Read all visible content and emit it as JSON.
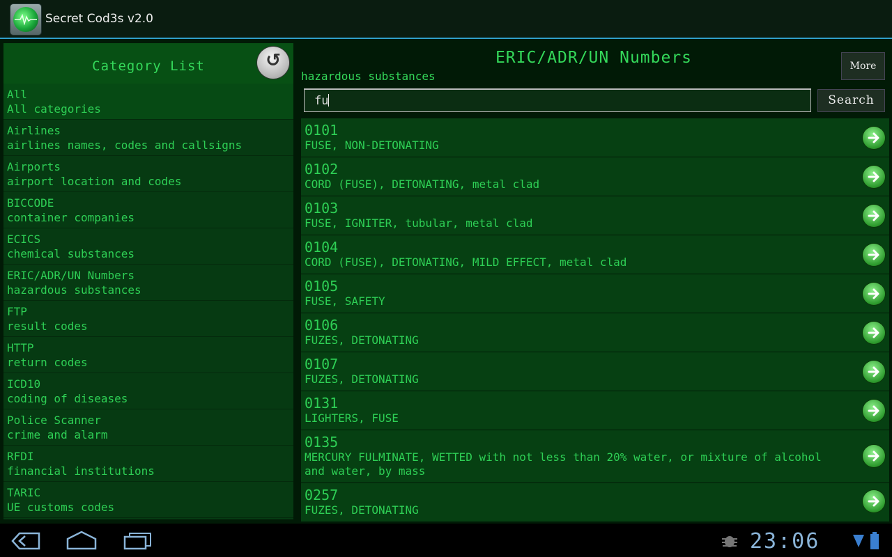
{
  "app": {
    "title": "Secret Cod3s v2.0"
  },
  "sidebar": {
    "title": "Category List",
    "refresh_icon": "↺",
    "items": [
      {
        "name": "All",
        "desc": "All categories"
      },
      {
        "name": "Airlines",
        "desc": "airlines names, codes and callsigns"
      },
      {
        "name": "Airports",
        "desc": "airport location and codes"
      },
      {
        "name": "BICCODE",
        "desc": "container companies"
      },
      {
        "name": "ECICS",
        "desc": "chemical substances"
      },
      {
        "name": "ERIC/ADR/UN Numbers",
        "desc": "hazardous substances"
      },
      {
        "name": "FTP",
        "desc": "result codes"
      },
      {
        "name": "HTTP",
        "desc": "return codes"
      },
      {
        "name": "ICD10",
        "desc": "coding of diseases"
      },
      {
        "name": "Police Scanner",
        "desc": "crime and alarm"
      },
      {
        "name": "RFDI",
        "desc": "financial institutions"
      },
      {
        "name": "TARIC",
        "desc": "UE customs codes"
      }
    ]
  },
  "main": {
    "title": "ERIC/ADR/UN Numbers",
    "subtitle": "hazardous substances",
    "more_label": "More",
    "search_value": "fu",
    "search_label": "Search",
    "results": [
      {
        "code": "0101",
        "desc": "FUSE, NON-DETONATING"
      },
      {
        "code": "0102",
        "desc": "CORD (FUSE), DETONATING, metal clad"
      },
      {
        "code": "0103",
        "desc": "FUSE, IGNITER, tubular, metal clad"
      },
      {
        "code": "0104",
        "desc": "CORD (FUSE), DETONATING, MILD EFFECT, metal clad"
      },
      {
        "code": "0105",
        "desc": "FUSE, SAFETY"
      },
      {
        "code": "0106",
        "desc": "FUZES, DETONATING"
      },
      {
        "code": "0107",
        "desc": "FUZES, DETONATING"
      },
      {
        "code": "0131",
        "desc": "LIGHTERS, FUSE"
      },
      {
        "code": "0135",
        "desc": "MERCURY FULMINATE, WETTED with not less than 20% water, or mixture of alcohol and water, by mass"
      },
      {
        "code": "0257",
        "desc": "FUZES, DETONATING"
      }
    ]
  },
  "statusbar": {
    "time": "23:06"
  },
  "colors": {
    "text_green": "#2ecf55",
    "panel_green": "#063a12",
    "accent_blue": "#2f9fc9"
  },
  "icons": [
    "app-radar-icon",
    "refresh-icon",
    "arrow-right-icon",
    "back-icon",
    "home-icon",
    "recent-apps-icon",
    "android-debug-icon",
    "wifi-icon",
    "battery-icon"
  ]
}
